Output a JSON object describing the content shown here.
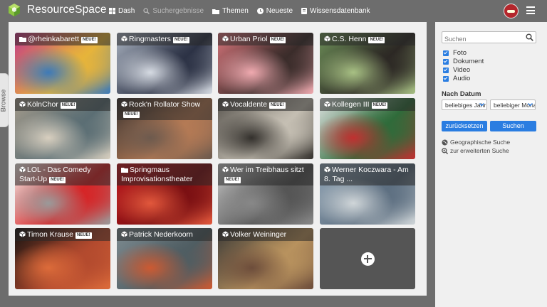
{
  "app": {
    "name": "ResourceSpace"
  },
  "nav": [
    {
      "label": "Dash",
      "icon": "grid-icon",
      "dim": false
    },
    {
      "label": "Suchergebnisse",
      "icon": "search-icon",
      "dim": true
    },
    {
      "label": "Themen",
      "icon": "folder-icon",
      "dim": false
    },
    {
      "label": "Neueste",
      "icon": "clock-icon",
      "dim": false
    },
    {
      "label": "Wissensdatenbank",
      "icon": "book-icon",
      "dim": false
    }
  ],
  "browse_label": "Browse",
  "badge_label": "NEUE!",
  "tiles": [
    {
      "title": "@rheinkabarett",
      "icon": "folder-icon",
      "badge": true,
      "colors": [
        "#c23a87",
        "#e7b43a",
        "#3d7ab8"
      ]
    },
    {
      "title": "Ringmasters",
      "icon": "cube-icon",
      "badge": true,
      "colors": [
        "#aab3c1",
        "#2c3245",
        "#d6dbe3"
      ]
    },
    {
      "title": "Urban Priol",
      "icon": "cube-icon",
      "badge": true,
      "colors": [
        "#d7757b",
        "#3a2c2a",
        "#f0aab0"
      ]
    },
    {
      "title": "C.S. Henn",
      "icon": "cube-icon",
      "badge": true,
      "colors": [
        "#6d8f58",
        "#2c2824",
        "#a8c184"
      ]
    },
    {
      "title": "KölnChor",
      "icon": "cube-icon",
      "badge": true,
      "colors": [
        "#a39a8b",
        "#5b6e74",
        "#d8cfbf"
      ]
    },
    {
      "title": "Rock'n Rollator Show",
      "icon": "cube-icon",
      "badge": true,
      "colors": [
        "#3a3330",
        "#b47a55",
        "#6d5a4e"
      ]
    },
    {
      "title": "Vocaldente",
      "icon": "cube-icon",
      "badge": true,
      "colors": [
        "#5a5650",
        "#c5bfb3",
        "#33302c"
      ]
    },
    {
      "title": "Kollegen III",
      "icon": "cube-icon",
      "badge": true,
      "colors": [
        "#dfe3e2",
        "#2f6b3a",
        "#c03030"
      ]
    },
    {
      "title": "LOL - Das Comedy Start-Up",
      "icon": "cube-icon",
      "badge": true,
      "colors": [
        "#f4f0ec",
        "#d62426",
        "#9a9a9a"
      ]
    },
    {
      "title": "Springmaus Improvisationstheater",
      "icon": "folder-icon",
      "badge": false,
      "colors": [
        "#c21a1f",
        "#7a0f12",
        "#e2583c"
      ]
    },
    {
      "title": "Wer im Treibhaus sitzt",
      "icon": "cube-icon",
      "badge": true,
      "colors": [
        "#c9c9c9",
        "#555555",
        "#888888"
      ]
    },
    {
      "title": "Werner Koczwara - Am 8. Tag ...",
      "icon": "cube-icon",
      "badge": false,
      "colors": [
        "#94a7b7",
        "#5d6f81",
        "#d0d6d9"
      ]
    },
    {
      "title": "Timon Krause",
      "icon": "cube-icon",
      "badge": true,
      "colors": [
        "#161311",
        "#b34a2e",
        "#dc6b3a"
      ]
    },
    {
      "title": "Patrick Nederkoorn",
      "icon": "cube-icon",
      "badge": false,
      "colors": [
        "#7e8c92",
        "#4f5d62",
        "#cc5a32"
      ]
    },
    {
      "title": "Volker Weininger",
      "icon": "cube-icon",
      "badge": false,
      "colors": [
        "#3c3a37",
        "#b8925e",
        "#6d4d3b"
      ]
    }
  ],
  "sidebar": {
    "search_placeholder": "Suchen",
    "filters": [
      "Foto",
      "Dokument",
      "Video",
      "Audio"
    ],
    "date_label": "Nach Datum",
    "select_1": "beliebiges Jahr",
    "select_2": "beliebiger Monat",
    "reset_label": "zurücksetzen",
    "search_label": "Suchen",
    "geo_search": "Geographische Suche",
    "advanced_search": "zur erweiterten Suche"
  },
  "colors": {
    "accent": "#2a7de1",
    "header": "#6d6d6d",
    "content_bg": "#f0f0f0"
  }
}
